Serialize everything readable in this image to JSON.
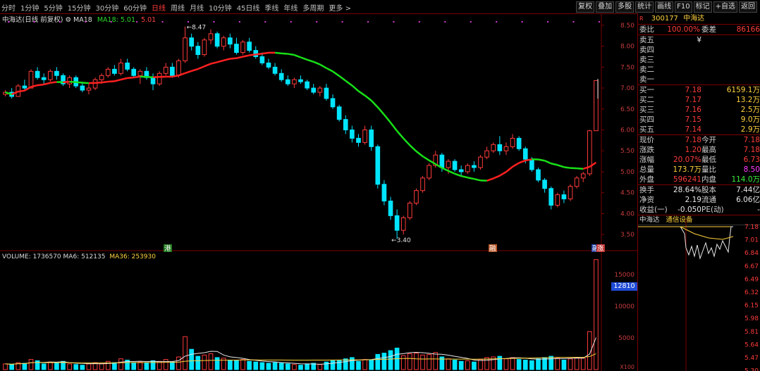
{
  "toolbar": {
    "tabs": [
      "分时",
      "1分钟",
      "5分钟",
      "15分钟",
      "30分钟",
      "60分钟",
      "日线",
      "周线",
      "月线",
      "10分钟",
      "45日线",
      "季线",
      "年线",
      "多周期",
      "更多 >"
    ],
    "active_tab": "日线",
    "tools": [
      "复权",
      "叠加",
      "多股",
      "统计",
      "画线",
      "F10",
      "标记",
      "+自选",
      "返回"
    ]
  },
  "chart": {
    "title": "中海达(日线 前复权)",
    "ma_label": "MA18",
    "ma_value": "MA18: 5.01",
    "price_label": "5.01",
    "y_ticks": [
      "8.50",
      "8.00",
      "7.50",
      "7.00",
      "6.50",
      "6.00",
      "5.50",
      "5.00",
      "4.50",
      "4.00",
      "3.50"
    ],
    "high_marker": "8.47",
    "low_marker": "3.40",
    "event_markers": [
      "港",
      "融",
      "融",
      "涨"
    ]
  },
  "volume": {
    "title": "VOLUME: 1736570",
    "ma6": "MA6: 512135",
    "ma36": "MA36: 253930",
    "y_ticks": [
      "15000",
      "10000",
      "5000"
    ],
    "multiplier": "X100",
    "badge": "12810"
  },
  "quote": {
    "code": "300177",
    "name": "中海达",
    "weibi_label": "委比",
    "weibi": "100.00%",
    "weicha_label": "委差",
    "weicha": "86166",
    "sell": [
      {
        "label": "卖五",
        "price": "",
        "vol": ""
      },
      {
        "label": "卖四",
        "price": "",
        "vol": ""
      },
      {
        "label": "卖三",
        "price": "",
        "vol": ""
      },
      {
        "label": "卖二",
        "price": "",
        "vol": ""
      },
      {
        "label": "卖一",
        "price": "",
        "vol": ""
      }
    ],
    "sell_currency": "¥",
    "buy": [
      {
        "label": "买一",
        "price": "7.18",
        "vol": "6159.1万"
      },
      {
        "label": "买二",
        "price": "7.17",
        "vol": "13.2万"
      },
      {
        "label": "买三",
        "price": "7.16",
        "vol": "2.5万"
      },
      {
        "label": "买四",
        "price": "7.15",
        "vol": "9.0万"
      },
      {
        "label": "买五",
        "price": "7.14",
        "vol": "2.9万"
      }
    ],
    "stats": [
      {
        "l1": "现价",
        "v1": "7.18",
        "l2": "今开",
        "v2": "7.18"
      },
      {
        "l1": "涨跌",
        "v1": "1.20",
        "l2": "最高",
        "v2": "7.18"
      },
      {
        "l1": "涨幅",
        "v1": "20.07%",
        "l2": "最低",
        "v2": "6.73"
      },
      {
        "l1": "总量",
        "v1": "173.7万",
        "l2": "量比",
        "v2": "8.50"
      },
      {
        "l1": "外盘",
        "v1": "596241",
        "l2": "内盘",
        "v2": "114.0万"
      }
    ],
    "stats2": [
      {
        "l1": "换手",
        "v1": "28.64%",
        "l2": "股本",
        "v2": "7.44亿"
      },
      {
        "l1": "净资",
        "v1": "2.19",
        "l2": "流通",
        "v2": "6.06亿"
      },
      {
        "l1": "收益(一)",
        "v1": "-0.050",
        "l2": "PE(动)",
        "v2": "-"
      }
    ]
  },
  "mini": {
    "name": "中海达",
    "sector": "通信设备",
    "ticks": [
      "7.18",
      "7.01",
      "6.84",
      "6.67",
      "6.49",
      "6.32",
      "6.15",
      "5.98",
      "5.81",
      "5.64",
      "5.47",
      "5.30"
    ]
  },
  "colors": {
    "up": "#ff3b3b",
    "down": "#00e5ff",
    "ma_up": "#ff2020",
    "ma_down": "#18e018",
    "bg": "#000000"
  },
  "chart_data": {
    "type": "candlestick",
    "title": "中海达(日线 前复权)",
    "ylim": [
      3.3,
      8.6
    ],
    "volume_ylim": [
      0,
      17000
    ],
    "candles": [
      [
        6.85,
        6.95,
        6.8,
        6.9,
        900
      ],
      [
        6.9,
        7.0,
        6.75,
        6.8,
        800
      ],
      [
        6.8,
        7.1,
        6.8,
        7.05,
        1100
      ],
      [
        7.05,
        7.2,
        6.95,
        7.0,
        1000
      ],
      [
        7.0,
        7.45,
        7.0,
        7.4,
        1600
      ],
      [
        7.4,
        7.5,
        7.2,
        7.25,
        1400
      ],
      [
        7.25,
        7.35,
        7.1,
        7.2,
        900
      ],
      [
        7.2,
        7.45,
        7.15,
        7.4,
        1200
      ],
      [
        7.4,
        7.5,
        7.2,
        7.3,
        1000
      ],
      [
        7.3,
        7.35,
        7.05,
        7.1,
        1300
      ],
      [
        7.1,
        7.3,
        7.0,
        7.25,
        900
      ],
      [
        7.25,
        7.3,
        7.0,
        7.05,
        800
      ],
      [
        7.05,
        7.15,
        6.9,
        6.95,
        700
      ],
      [
        6.95,
        7.1,
        6.85,
        7.0,
        900
      ],
      [
        7.0,
        7.25,
        6.95,
        7.2,
        1100
      ],
      [
        7.2,
        7.35,
        7.1,
        7.3,
        1000
      ],
      [
        7.3,
        7.5,
        7.25,
        7.45,
        1300
      ],
      [
        7.45,
        7.55,
        7.3,
        7.35,
        1100
      ],
      [
        7.35,
        7.7,
        7.3,
        7.6,
        1700
      ],
      [
        7.6,
        7.7,
        7.4,
        7.45,
        1500
      ],
      [
        7.45,
        7.5,
        7.25,
        7.3,
        1100
      ],
      [
        7.3,
        7.45,
        7.1,
        7.4,
        1200
      ],
      [
        7.4,
        7.5,
        7.2,
        7.25,
        1000
      ],
      [
        7.25,
        7.35,
        6.95,
        7.1,
        1400
      ],
      [
        7.1,
        7.4,
        7.05,
        7.35,
        1300
      ],
      [
        7.35,
        7.6,
        7.3,
        7.5,
        1600
      ],
      [
        7.5,
        7.6,
        7.25,
        7.3,
        1200
      ],
      [
        7.3,
        7.7,
        7.25,
        7.65,
        2000
      ],
      [
        7.65,
        8.47,
        7.6,
        8.2,
        5200
      ],
      [
        8.2,
        8.3,
        7.9,
        8.0,
        3200
      ],
      [
        8.0,
        8.1,
        7.7,
        7.8,
        2100
      ],
      [
        7.8,
        8.2,
        7.75,
        8.15,
        2300
      ],
      [
        8.15,
        8.4,
        8.05,
        8.3,
        2500
      ],
      [
        8.3,
        8.35,
        7.95,
        8.0,
        1900
      ],
      [
        8.0,
        8.25,
        7.9,
        8.2,
        1800
      ],
      [
        8.2,
        8.3,
        7.95,
        8.05,
        1500
      ],
      [
        8.05,
        8.2,
        7.8,
        7.85,
        1400
      ],
      [
        7.85,
        8.15,
        7.8,
        8.1,
        1600
      ],
      [
        8.1,
        8.2,
        7.85,
        7.9,
        1300
      ],
      [
        7.9,
        8.0,
        7.7,
        7.75,
        1200
      ],
      [
        7.75,
        7.85,
        7.55,
        7.6,
        1100
      ],
      [
        7.6,
        7.7,
        7.45,
        7.5,
        1000
      ],
      [
        7.5,
        7.6,
        7.3,
        7.35,
        1100
      ],
      [
        7.35,
        7.45,
        7.15,
        7.2,
        1000
      ],
      [
        7.2,
        7.3,
        7.05,
        7.1,
        900
      ],
      [
        7.1,
        7.25,
        7.0,
        7.2,
        800
      ],
      [
        7.2,
        7.3,
        7.1,
        7.15,
        700
      ],
      [
        7.15,
        7.2,
        6.95,
        7.0,
        900
      ],
      [
        7.0,
        7.1,
        6.85,
        6.9,
        1000
      ],
      [
        6.9,
        7.05,
        6.8,
        7.0,
        800
      ],
      [
        7.0,
        7.1,
        6.7,
        6.75,
        1200
      ],
      [
        6.75,
        6.85,
        6.5,
        6.55,
        1400
      ],
      [
        6.55,
        6.6,
        6.2,
        6.25,
        1500
      ],
      [
        6.25,
        6.35,
        5.9,
        6.0,
        1700
      ],
      [
        6.0,
        6.1,
        5.7,
        5.8,
        1900
      ],
      [
        5.8,
        5.9,
        5.6,
        5.7,
        1300
      ],
      [
        5.7,
        6.1,
        5.65,
        6.0,
        1600
      ],
      [
        6.0,
        6.1,
        5.5,
        5.6,
        1500
      ],
      [
        5.6,
        5.65,
        4.6,
        4.7,
        2400
      ],
      [
        4.7,
        4.8,
        4.2,
        4.3,
        2600
      ],
      [
        4.3,
        4.4,
        3.85,
        3.95,
        3000
      ],
      [
        3.95,
        4.1,
        3.4,
        3.6,
        3400
      ],
      [
        3.6,
        3.95,
        3.5,
        3.9,
        2200
      ],
      [
        3.9,
        4.3,
        3.85,
        4.25,
        2500
      ],
      [
        4.25,
        4.6,
        4.2,
        4.55,
        2600
      ],
      [
        4.55,
        4.9,
        4.5,
        4.85,
        2300
      ],
      [
        4.85,
        5.2,
        4.8,
        5.15,
        2400
      ],
      [
        5.15,
        5.5,
        5.1,
        5.4,
        2700
      ],
      [
        5.4,
        5.45,
        5.0,
        5.1,
        2000
      ],
      [
        5.1,
        5.3,
        4.95,
        5.25,
        1700
      ],
      [
        5.25,
        5.3,
        5.0,
        5.05,
        1500
      ],
      [
        5.05,
        5.15,
        4.9,
        5.0,
        1300
      ],
      [
        5.0,
        5.2,
        4.95,
        5.15,
        1400
      ],
      [
        5.15,
        5.25,
        5.0,
        5.1,
        1200
      ],
      [
        5.1,
        5.4,
        5.05,
        5.35,
        1600
      ],
      [
        5.35,
        5.6,
        5.3,
        5.5,
        1900
      ],
      [
        5.5,
        5.7,
        5.45,
        5.65,
        2000
      ],
      [
        5.65,
        5.85,
        5.4,
        5.5,
        2100
      ],
      [
        5.5,
        5.7,
        5.4,
        5.6,
        1700
      ],
      [
        5.6,
        5.9,
        5.55,
        5.8,
        1900
      ],
      [
        5.8,
        5.85,
        5.5,
        5.55,
        1600
      ],
      [
        5.55,
        5.6,
        5.2,
        5.3,
        1500
      ],
      [
        5.3,
        5.35,
        5.0,
        5.05,
        1400
      ],
      [
        5.05,
        5.1,
        4.75,
        4.8,
        1700
      ],
      [
        4.8,
        4.85,
        4.5,
        4.6,
        1900
      ],
      [
        4.6,
        4.65,
        4.1,
        4.2,
        2100
      ],
      [
        4.2,
        4.5,
        4.15,
        4.45,
        1800
      ],
      [
        4.45,
        4.55,
        4.25,
        4.35,
        1500
      ],
      [
        4.35,
        4.7,
        4.3,
        4.65,
        1700
      ],
      [
        4.65,
        4.9,
        4.6,
        4.85,
        1900
      ],
      [
        4.85,
        5.0,
        4.75,
        4.95,
        1800
      ],
      [
        4.95,
        6.0,
        4.9,
        5.98,
        6000
      ],
      [
        5.98,
        7.18,
        6.73,
        7.18,
        17365
      ]
    ]
  }
}
